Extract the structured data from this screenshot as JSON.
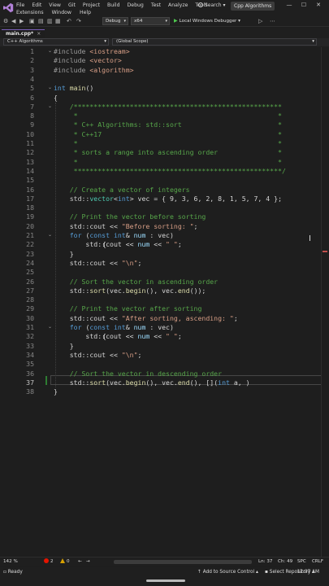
{
  "menu": {
    "row1": [
      "File",
      "Edit",
      "View",
      "Git",
      "Project",
      "Build",
      "Debug",
      "Test",
      "Analyze",
      "Tools"
    ],
    "row2": [
      "Extensions",
      "Window",
      "Help"
    ],
    "search_label": "Search",
    "project_name": "Cpp Algorithms"
  },
  "toolbar": {
    "config": "Debug",
    "platform": "x64",
    "debugger": "Local Windows Debugger"
  },
  "tab": {
    "filename": "main.cpp*",
    "close": "×"
  },
  "breadcrumbs": {
    "project": "C++ Algorithms",
    "scope": "(Global Scope)"
  },
  "editor": {
    "line_numbers": [
      "1",
      "2",
      "3",
      "4",
      "5",
      "6",
      "7",
      "8",
      "9",
      "10",
      "11",
      "12",
      "13",
      "14",
      "15",
      "16",
      "17",
      "18",
      "19",
      "20",
      "21",
      "22",
      "23",
      "24",
      "25",
      "26",
      "27",
      "28",
      "29",
      "30",
      "31",
      "32",
      "33",
      "34",
      "35",
      "36",
      "37",
      "38"
    ],
    "active_line": "37",
    "lines": {
      "l1a": "#include ",
      "l1b": "<iostream>",
      "l2a": "#include ",
      "l2b": "<vector>",
      "l3a": "#include ",
      "l3b": "<algorithm>",
      "l5a": "int ",
      "l5b": "main",
      "l5c": "()",
      "l6": "{",
      "l7": "    /****************************************************",
      "l8": "     *                                                  *",
      "l9": "     * C++ Algorithms: std::sort                        *",
      "l10": "     * C++17                                            *",
      "l11": "     *                                                  *",
      "l12": "     * sorts a range into ascending order               *",
      "l13": "     *                                                  *",
      "l14": "     ****************************************************/",
      "l16": "    // Create a vector of integers",
      "l17a": "    std::",
      "l17b": "vector",
      "l17c": "<",
      "l17d": "int",
      "l17e": "> vec = { 9, 3, 6, 2, 8, 1, 5, 7, 4 };",
      "l19": "    // Print the vector before sorting",
      "l20a": "    std::cout << ",
      "l20b": "\"Before sorting: \"",
      "l20c": ";",
      "l21a": "    ",
      "l21b": "for",
      "l21c": " (",
      "l21d": "const int",
      "l21e": "& ",
      "l21f": "num",
      "l21g": " : vec)",
      "l22": "{",
      "l23a": "        std::cout << ",
      "l23b": "num",
      "l23c": " << ",
      "l23d": "\" \"",
      "l23e": ";",
      "l24": "    }",
      "l25a": "    std::cout << ",
      "l25b": "\"\\n\"",
      "l25c": ";",
      "l27": "    // Sort the vector in ascending order",
      "l28a": "    std::",
      "l28b": "sort",
      "l28c": "(vec.",
      "l28d": "begin",
      "l28e": "(), vec.",
      "l28f": "end",
      "l28g": "());",
      "l30": "    // Print the vector after sorting",
      "l31a": "    std::cout << ",
      "l31b": "\"After sorting, ascending: \"",
      "l31c": ";",
      "l32a": "    ",
      "l32b": "for",
      "l32c": " (",
      "l32d": "const int",
      "l32e": "& ",
      "l32f": "num",
      "l32g": " : vec)",
      "l33": "{",
      "l34a": "        std::cout << ",
      "l34b": "num",
      "l34c": " << ",
      "l34d": "\" \"",
      "l34e": ";",
      "l35": "    }",
      "l36a": "    std::cout << ",
      "l36b": "\"\\n\"",
      "l36c": ";",
      "l37": "    // Sort the vector in descending order",
      "l38a": "    std::",
      "l38b": "sort",
      "l38c": "(vec.",
      "l38d": "begin",
      "l38e": "(), vec.",
      "l38f": "end",
      "l38g": "(), [](",
      "l38h": "int",
      "l38i": " a, ",
      "l38j": ")",
      "l39": "}"
    }
  },
  "infobar": {
    "zoom": "142 %",
    "errors": "2",
    "warnings": "0",
    "line": "Ln: 37",
    "col": "Ch: 49",
    "spc": "SPC",
    "eol": "CRLF"
  },
  "status": {
    "ready": "Ready",
    "source_control": "Add to Source Control",
    "repo": "Select Repository",
    "time": "12:07 AM"
  },
  "colors": {
    "accent": "#7a5fb8",
    "comment": "#57a64a",
    "keyword": "#569cd6",
    "string": "#d69d85",
    "type": "#4ec9b0",
    "error": "#e51400"
  }
}
